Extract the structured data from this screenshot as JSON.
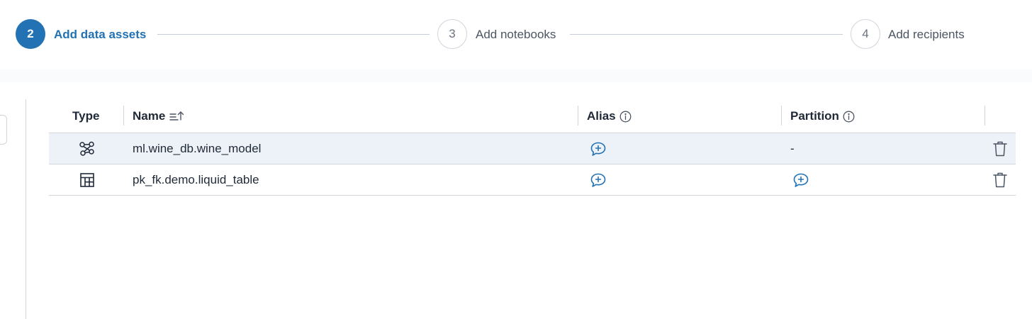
{
  "stepper": {
    "steps": [
      {
        "number": "2",
        "label": "Add data assets",
        "state": "active"
      },
      {
        "number": "3",
        "label": "Add notebooks",
        "state": "inactive"
      },
      {
        "number": "4",
        "label": "Add recipients",
        "state": "inactive"
      }
    ]
  },
  "table": {
    "headers": {
      "type": "Type",
      "name": "Name",
      "alias": "Alias",
      "partition": "Partition"
    },
    "rows": [
      {
        "type_icon": "model-icon",
        "name": "ml.wine_db.wine_model",
        "alias_icon": "add-comment-icon",
        "partition": "-",
        "highlighted": true
      },
      {
        "type_icon": "table-icon",
        "name": "pk_fk.demo.liquid_table",
        "alias_icon": "add-comment-icon",
        "partition_icon": "add-comment-icon",
        "highlighted": false
      }
    ]
  },
  "colors": {
    "accent": "#2272b4",
    "border": "#d1d5db",
    "row_highlight": "#edf2f8"
  }
}
